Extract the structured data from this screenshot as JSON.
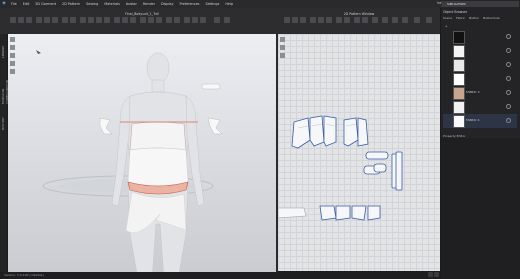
{
  "menu": {
    "items": [
      "File",
      "Edit",
      "3D Garment",
      "2D Pattern",
      "Sewing",
      "Materials",
      "Avatar",
      "Render",
      "Display",
      "Preferences",
      "Settings",
      "Help"
    ],
    "user": "hello_zeroskin@1.0",
    "mode": "SIMULATION"
  },
  "views": {
    "view3d_title": "Final_Bodysuit_1_Tutl",
    "view2d_title": "2D Pattern Window"
  },
  "left_strip": {
    "labels": [
      "LIBRARY",
      "MODULAR CONFIGURATOR",
      "HISTORY"
    ]
  },
  "right_panel": {
    "title": "Object Browser",
    "tabs": [
      "Scene",
      "Fabric",
      "Button",
      "Buttonhole"
    ],
    "fabrics": [
      {
        "label": "",
        "color": "#111111"
      },
      {
        "label": "",
        "color": "#f4f4f4"
      },
      {
        "label": "",
        "color": "#e9e9e9"
      },
      {
        "label": "",
        "color": "#ffffff"
      },
      {
        "label": "FABRIC 3",
        "color": "#c9a48e"
      },
      {
        "label": "",
        "color": "#f1f1f1"
      },
      {
        "label": "FABRIC 4",
        "color": "#fafafa"
      }
    ],
    "property_title": "Property Editor"
  },
  "status": {
    "text": "Version: 5.0.100 (rc9e5a1)"
  }
}
